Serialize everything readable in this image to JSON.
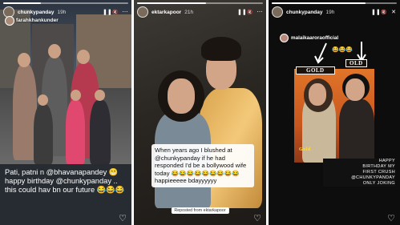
{
  "stories": [
    {
      "username": "chunkypanday",
      "time": "19h",
      "progress": 0.3,
      "tagged_user": "farahkhankunder",
      "caption": "Pati, patni n @bhavanapandey 😁 happy birthday @chunkypanday .. this could hav bn our future 😂😂😂",
      "heart": "♡"
    },
    {
      "username": "ektarkapoor",
      "time": "21h",
      "progress": 0.55,
      "caption": "When years ago I blushed at @chunkypanday  if he had responded I'd be a bollywood wife today 😂😂😂😂😂😂😂😂😂 happieeeee bdayyyyyy",
      "reposted_from": "Reposted from ektarkapoor",
      "heart": "♡"
    },
    {
      "username": "chunkypanday",
      "time": "19h",
      "progress": 0.75,
      "mention": "malaikaaroraofficial",
      "mention_emoji": "😂😂😂",
      "labels": [
        "GOLD",
        "OLD"
      ],
      "caption_lines": [
        "HAPPY",
        "BIRTHDAY MY",
        "FIRST CRUSH",
        "@CHUNKYPANDAY",
        "ONLY JOKING"
      ],
      "gold_badge": "Gold",
      "heart": "♡"
    }
  ],
  "icons": {
    "pause": "❚❚",
    "mute": "🔇",
    "more": "⋯",
    "close": "✕"
  },
  "colors": {
    "panel3_bg": "#0d0d0d",
    "gold_box_border": "#ffffff",
    "emoji_yellow": "#ffd84a"
  }
}
